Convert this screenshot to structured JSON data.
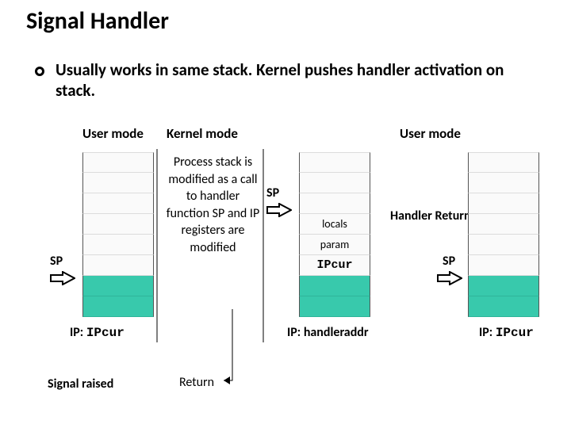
{
  "title": "Signal Handler",
  "bullet": "Usually works in same stack. Kernel pushes handler activation on stack.",
  "modes": {
    "user1": "User mode",
    "kernel": "Kernel mode",
    "user2": "User mode"
  },
  "kernel_desc": "Process stack is modified as a call to handler function SP and IP registers are modified",
  "sp_label": "SP",
  "stack3": {
    "locals": "locals",
    "param": "param",
    "ipcur": "IPcur"
  },
  "side_label": "Handler Returns",
  "ip": {
    "left_prefix": "IP: ",
    "left_mono": "IPcur",
    "mid": "IP: handleraddr",
    "right_prefix": "IP: ",
    "right_mono": "IPcur"
  },
  "signal_raised": "Signal raised",
  "return_label": "Return"
}
